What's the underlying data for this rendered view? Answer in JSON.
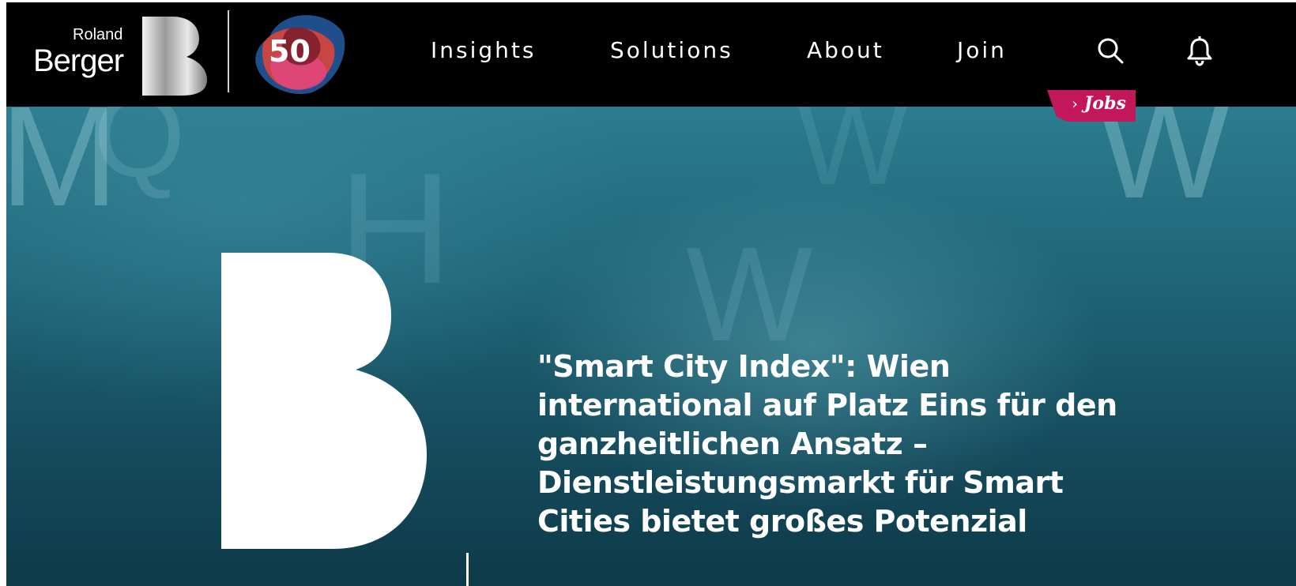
{
  "brand": {
    "small_text": "Roland",
    "main_text": "Berger",
    "anniversary_text": "50"
  },
  "nav": {
    "items": [
      {
        "label": "Insights"
      },
      {
        "label": "Solutions"
      },
      {
        "label": "About"
      },
      {
        "label": "Join"
      }
    ],
    "jobs_label": "Jobs"
  },
  "icons": {
    "search": "search-icon",
    "notifications": "bell-icon",
    "jobs_chevron": "chevron-right-icon"
  },
  "hero": {
    "headline": "\"Smart City Index\": Wien international auf Platz Eins für den ganzheitlichen Ansatz – Dienstleistungsmarkt für Smart Cities bietet großes Potenzial"
  },
  "colors": {
    "header_bg": "#000000",
    "jobs_badge": "#c2185b",
    "hero_teal": "#1f6678",
    "text": "#ffffff"
  }
}
